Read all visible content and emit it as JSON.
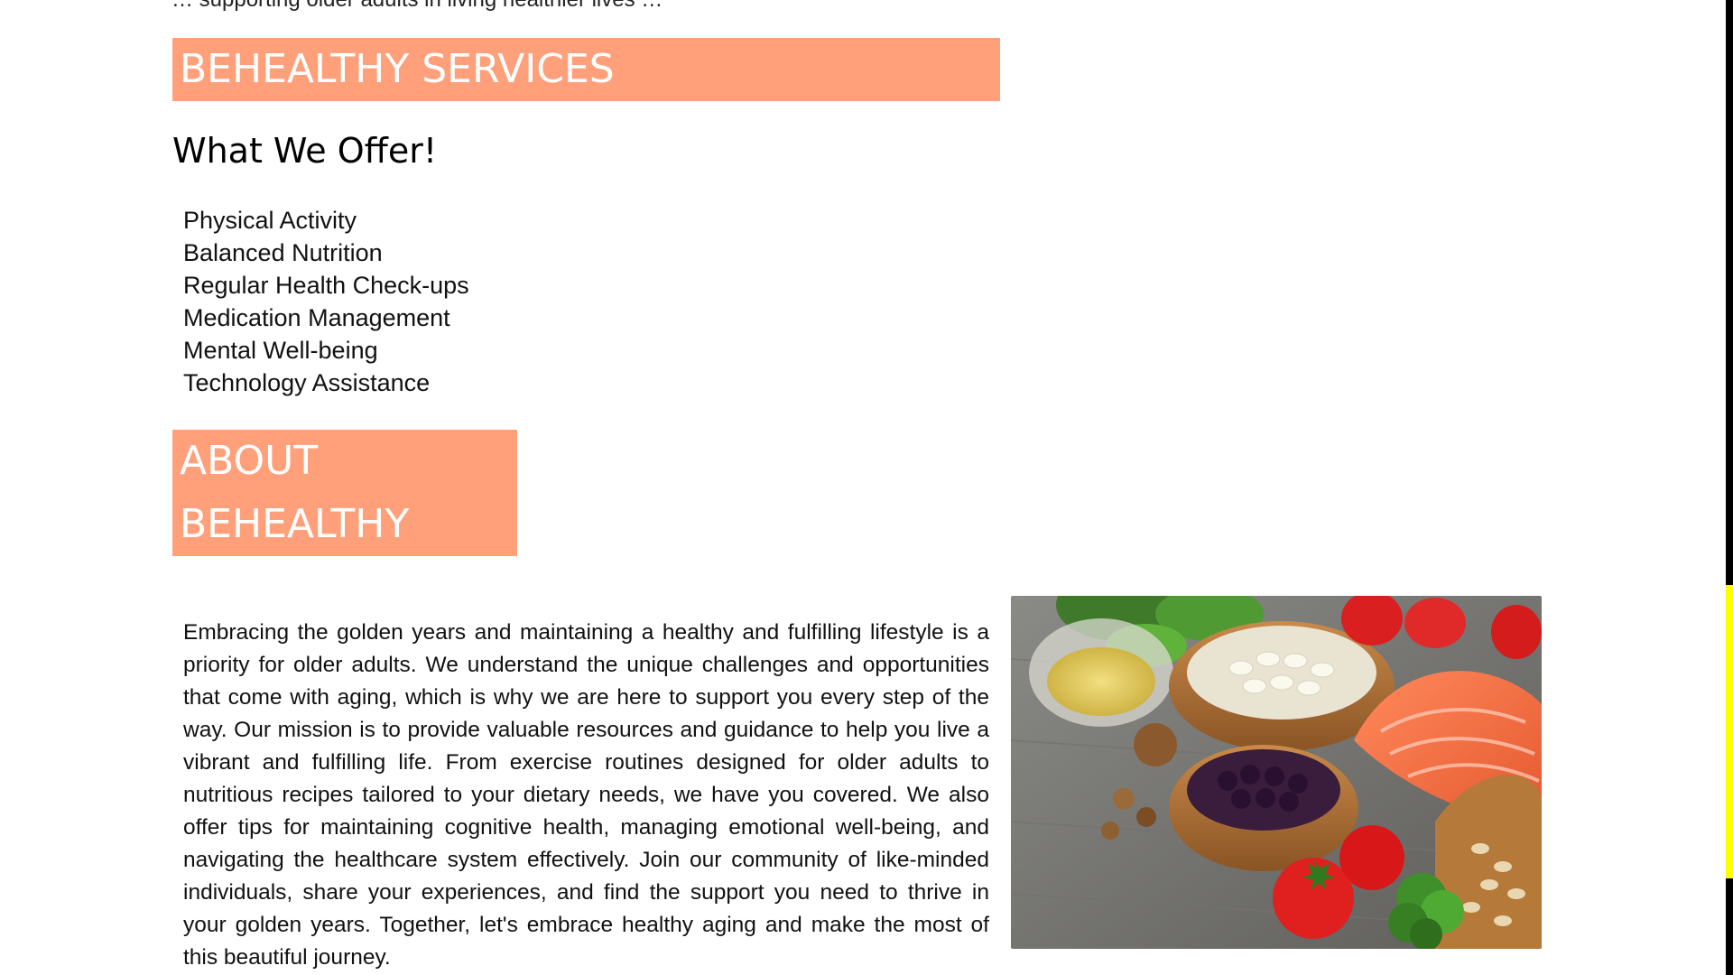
{
  "top_cut_text": "… supporting older adults in living healthier lives …",
  "sections": {
    "services": {
      "heading": "BEHEALTHY SERVICES",
      "subheading": "What We Offer!",
      "items": [
        "Physical Activity",
        "Balanced Nutrition",
        "Regular Health Check-ups",
        "Medication Management",
        "Mental Well-being",
        "Technology Assistance"
      ]
    },
    "about": {
      "heading_line1": "ABOUT",
      "heading_line2": "BEHEALTHY",
      "paragraph": "Embracing the golden years and maintaining a healthy and fulfilling lifestyle is a priority for older adults. We understand the unique challenges and opportunities that come with aging, which is why we are here to support you every step of the way. Our mission is to provide valuable resources and guidance to help you live a vibrant and fulfilling life. From exercise routines designed for older adults to nutritious recipes tailored to your dietary needs, we have you covered. We also offer tips for maintaining cognitive health, managing emotional well-being, and navigating the healthcare system effectively. Join our community of like-minded individuals, share your experiences, and find the support you need to thrive in your golden years. Together, let's embrace healthy aging and make the most of this beautiful journey."
    }
  },
  "colors": {
    "banner_bg": "#ffa07a",
    "banner_text": "#ffffff",
    "scroll_track": "#000000",
    "scroll_thumb": "#ffff00"
  },
  "image": {
    "alt": "healthy-food-icon"
  }
}
